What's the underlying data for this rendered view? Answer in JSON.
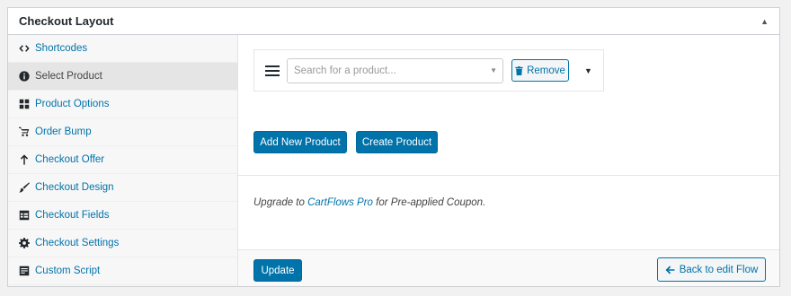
{
  "metabox": {
    "title": "Checkout Layout"
  },
  "sidebar": {
    "items": [
      {
        "label": "Shortcodes",
        "icon": "code-icon"
      },
      {
        "label": "Select Product",
        "icon": "info-icon"
      },
      {
        "label": "Product Options",
        "icon": "grid-icon"
      },
      {
        "label": "Order Bump",
        "icon": "cart-icon"
      },
      {
        "label": "Checkout Offer",
        "icon": "arrow-up-icon"
      },
      {
        "label": "Checkout Design",
        "icon": "brush-icon"
      },
      {
        "label": "Checkout Fields",
        "icon": "table-icon"
      },
      {
        "label": "Checkout Settings",
        "icon": "gear-icon"
      },
      {
        "label": "Custom Script",
        "icon": "document-icon"
      }
    ],
    "active_index": 1
  },
  "product": {
    "search_placeholder": "Search for a product...",
    "remove_label": "Remove"
  },
  "buttons": {
    "add_new_product": "Add New Product",
    "create_product": "Create Product",
    "update": "Update",
    "back_to_flow": "Back to edit Flow"
  },
  "upgrade": {
    "prefix": "Upgrade to ",
    "link_text": "CartFlows Pro",
    "suffix": " for Pre-applied Coupon."
  },
  "colors": {
    "accent": "#0073aa",
    "active_item_bg": "#e5e5e5"
  }
}
